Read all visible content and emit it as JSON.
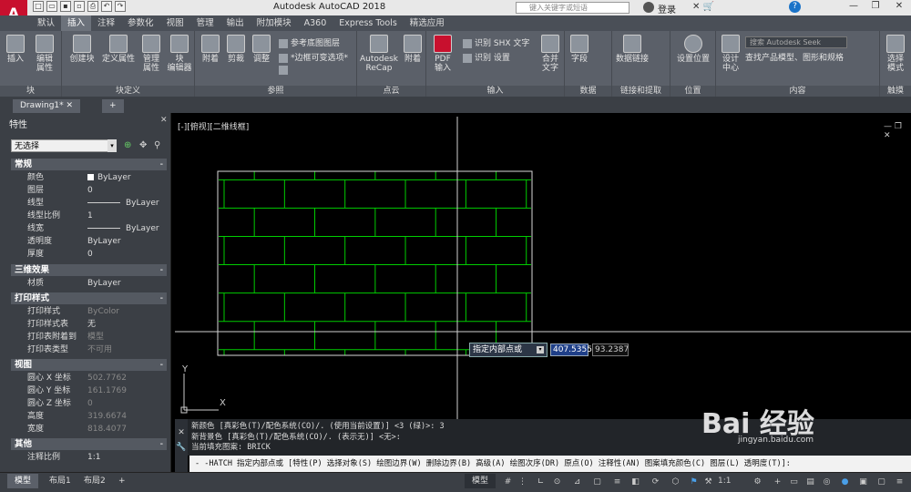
{
  "app": {
    "logo": "A",
    "title": "Autodesk AutoCAD 2018",
    "search_placeholder": "键入关键字或短语",
    "login": "登录"
  },
  "ribbon_tabs": [
    "默认",
    "插入",
    "注释",
    "参数化",
    "视图",
    "管理",
    "输出",
    "附加模块",
    "A360",
    "Express Tools",
    "精选应用"
  ],
  "ribbon": {
    "block_group": "块",
    "insert": "插入",
    "edit_attr": "编辑\n属性",
    "blockdef_group": "块定义",
    "create_block": "创建块",
    "define_attr": "定义属性",
    "manage_attr": "管理\n属性",
    "block_editor": "块\n编辑器",
    "reference_group": "参照",
    "attach": "附着",
    "clip": "剪裁",
    "adjust": "调整",
    "ref_underlay_layers": "参考底图图层",
    "frame_variable": "*边框可变选项*",
    "pointcloud_group": "点云",
    "recap": "Autodesk\nReCap",
    "attach2": "附着",
    "import_group": "输入",
    "pdf_import": "PDF\n输入",
    "recognize_shx": "识别 SHX 文字",
    "recognize_settings": "识别 设置",
    "merge_text": "合并\n文字",
    "data_group": "数据",
    "field": "字段",
    "link_group": "链接和提取",
    "data_link": "数据链接",
    "location_group": "位置",
    "set_location": "设置位置",
    "content_group": "内容",
    "design_center": "设计\n中心",
    "seek_placeholder": "搜索 Autodesk Seek",
    "seek_desc": "查找产品模型、图形和规格",
    "touch_group": "触摸",
    "select_mode": "选择\n模式"
  },
  "doc_tab": "Drawing1*",
  "properties": {
    "title": "特性",
    "selection": "无选择",
    "sections": {
      "general": "常规",
      "threed": "三维效果",
      "plot": "打印样式",
      "view": "视图",
      "misc": "其他"
    },
    "rows": {
      "color_k": "颜色",
      "color_v": "ByLayer",
      "layer_k": "图层",
      "layer_v": "0",
      "linetype_k": "线型",
      "linetype_v": "ByLayer",
      "ltscale_k": "线型比例",
      "ltscale_v": "1",
      "lineweight_k": "线宽",
      "lineweight_v": "ByLayer",
      "transparency_k": "透明度",
      "transparency_v": "ByLayer",
      "thickness_k": "厚度",
      "thickness_v": "0",
      "material_k": "材质",
      "material_v": "ByLayer",
      "plotstyle_k": "打印样式",
      "plotstyle_v": "ByColor",
      "plottable_k": "打印样式表",
      "plottable_v": "无",
      "plotattach_k": "打印表附着到",
      "plotattach_v": "模型",
      "plottype_k": "打印表类型",
      "plottype_v": "不可用",
      "cx_k": "圆心 X 坐标",
      "cx_v": "502.7762",
      "cy_k": "圆心 Y 坐标",
      "cy_v": "161.1769",
      "cz_k": "圆心 Z 坐标",
      "cz_v": "0",
      "height_k": "高度",
      "height_v": "319.6674",
      "width_k": "宽度",
      "width_v": "818.4077",
      "annoscale_k": "注释比例",
      "annoscale_v": "1:1"
    }
  },
  "viewport": {
    "label": "[-][俯视][二维线框]",
    "prompt": "指定内部点或",
    "coord_x": "407.5355",
    "coord_y": "93.2387",
    "ucs_x": "X",
    "ucs_y": "Y"
  },
  "hatch": {
    "color": "#00cc00",
    "rows": 6,
    "cols": 5
  },
  "command": {
    "line1": "新颜色 [真彩色(T)/配色系统(CO)/. (使用当前设置)] <3 (绿)>: 3",
    "line2": "新背景色 [真彩色(T)/配色系统(CO)/. (表示无)] <无>:",
    "line3": "当前填充图案:  BRICK",
    "input": "- -HATCH 指定内部点或 [特性(P) 选择对象(S) 绘图边界(W) 删除边界(B) 高级(A) 绘图次序(DR) 原点(O) 注释性(AN) 图案填充颜色(C) 图层(L) 透明度(T)]:"
  },
  "status": {
    "layout_model": "模型",
    "layout1": "布局1",
    "layout2": "布局2",
    "model_btn": "模型",
    "scale": "1:1"
  },
  "watermark": {
    "brand": "Bai 经验",
    "url": "jingyan.baidu.com"
  }
}
